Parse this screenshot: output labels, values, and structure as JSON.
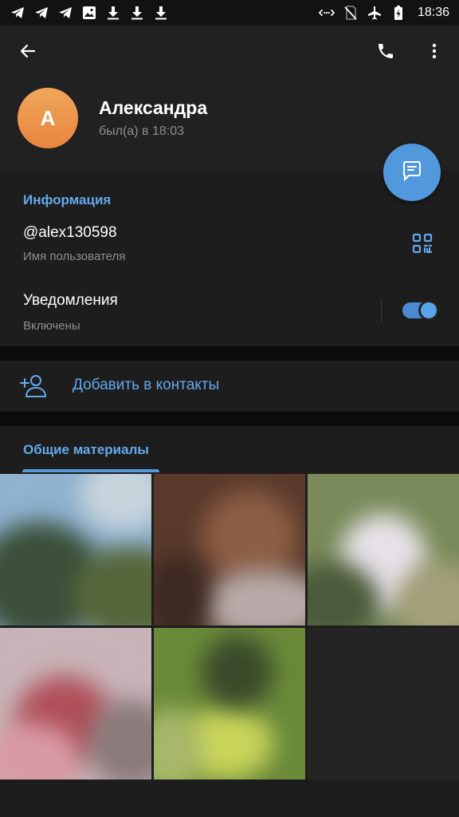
{
  "status_bar": {
    "time": "18:36",
    "left_icons": [
      "telegram-icon",
      "telegram-icon",
      "telegram-icon",
      "image-icon",
      "download-icon",
      "download-icon",
      "download-icon"
    ],
    "right_icons": [
      "data-transfer-icon",
      "no-sim-icon",
      "airplane-mode-icon",
      "battery-icon"
    ]
  },
  "header": {
    "back_icon": "arrow-left-icon",
    "call_icon": "phone-icon",
    "more_icon": "more-vertical-icon",
    "avatar_letter": "А",
    "name": "Александра",
    "last_seen": "был(а) в 18:03",
    "avatar_color": "#ea8a45"
  },
  "fab": {
    "icon": "message-icon",
    "color": "#5298dc"
  },
  "info": {
    "title": "Информация",
    "username": "@alex130598",
    "username_label": "Имя пользователя",
    "qr_icon": "qr-code-icon",
    "notifications_label": "Уведомления",
    "notifications_status": "Включены",
    "notifications_enabled": true
  },
  "add_contact": {
    "icon": "add-user-icon",
    "label": "Добавить в контакты"
  },
  "media": {
    "title": "Общие материалы",
    "items": [
      {
        "id": "media-1",
        "palette": [
          "#8fb2cf",
          "#3b4f3a",
          "#56663a",
          "#c8d4dc"
        ]
      },
      {
        "id": "media-2",
        "palette": [
          "#5a3a2c",
          "#8c5e44",
          "#b7aaa8",
          "#3d2a22"
        ]
      },
      {
        "id": "media-3",
        "palette": [
          "#7a8a5a",
          "#e6e2e8",
          "#4b5a3a",
          "#a4a07c"
        ]
      },
      {
        "id": "media-4",
        "palette": [
          "#c8b4b8",
          "#b0505a",
          "#d89aa4",
          "#8a7a7a"
        ]
      },
      {
        "id": "media-5",
        "palette": [
          "#6a8a3a",
          "#c8d45a",
          "#3a4a2a",
          "#a8b86a"
        ]
      }
    ]
  },
  "colors": {
    "accent": "#64a9ee",
    "background": "#1d1d1d",
    "header_bg": "#212121"
  }
}
